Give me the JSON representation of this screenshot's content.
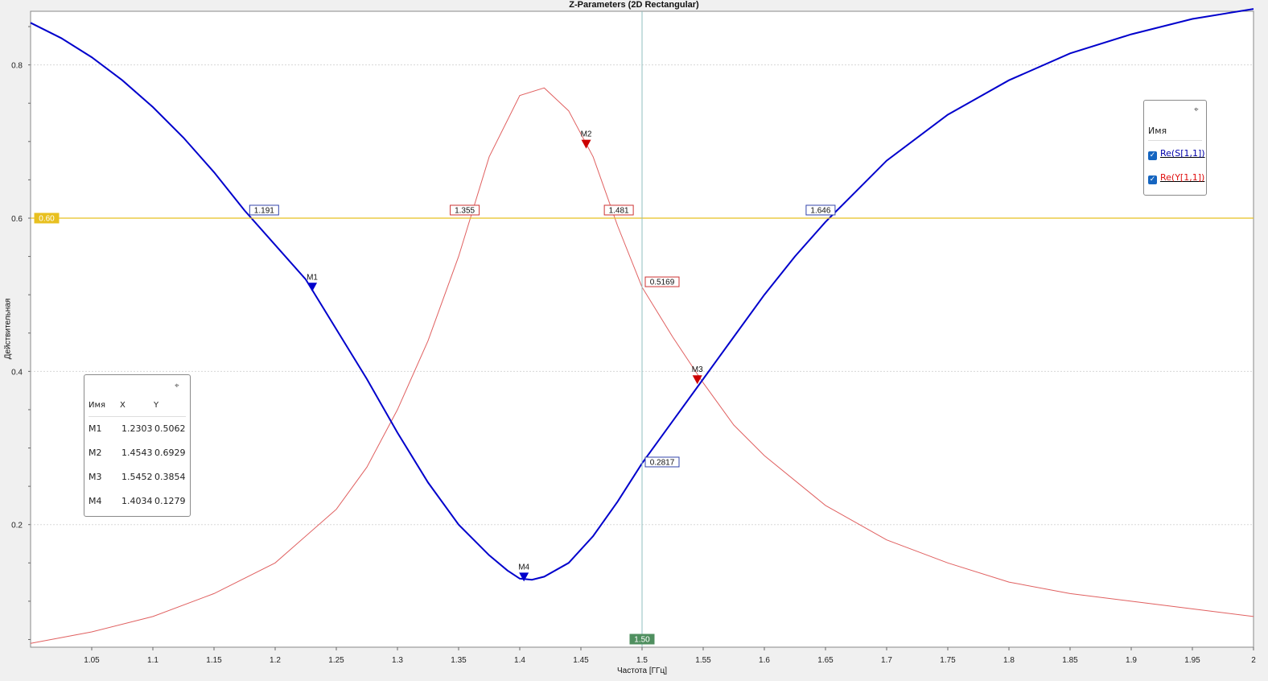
{
  "chart_data": {
    "type": "line",
    "title": "Z-Parameters (2D Rectangular)",
    "xlabel": "Частота [ГГц]",
    "ylabel": "Действительная",
    "xlim": [
      1.0,
      2.0
    ],
    "ylim": [
      0.04,
      0.87
    ],
    "x_ticks": [
      "1.05",
      "1.1",
      "1.15",
      "1.2",
      "1.25",
      "1.3",
      "1.35",
      "1.4",
      "1.45",
      "1.5",
      "1.55",
      "1.6",
      "1.65",
      "1.7",
      "1.75",
      "1.8",
      "1.85",
      "1.9",
      "1.95",
      "2"
    ],
    "y_ticks": [
      "0.2",
      "0.4",
      "0.6",
      "0.8"
    ],
    "grid": true,
    "legend_position": "top-right",
    "series": [
      {
        "name": "Re(S[1,1])",
        "color": "#0000cc",
        "x": [
          1.0,
          1.025,
          1.05,
          1.075,
          1.1,
          1.125,
          1.15,
          1.175,
          1.2,
          1.225,
          1.25,
          1.275,
          1.3,
          1.325,
          1.35,
          1.375,
          1.39,
          1.4,
          1.41,
          1.42,
          1.44,
          1.46,
          1.48,
          1.5,
          1.525,
          1.55,
          1.575,
          1.6,
          1.625,
          1.65,
          1.675,
          1.7,
          1.75,
          1.8,
          1.85,
          1.9,
          1.95,
          2.0
        ],
        "y": [
          0.855,
          0.835,
          0.81,
          0.78,
          0.745,
          0.705,
          0.66,
          0.61,
          0.565,
          0.52,
          0.455,
          0.39,
          0.32,
          0.255,
          0.2,
          0.16,
          0.14,
          0.1295,
          0.128,
          0.132,
          0.15,
          0.185,
          0.23,
          0.28,
          0.335,
          0.39,
          0.445,
          0.5,
          0.55,
          0.595,
          0.635,
          0.675,
          0.735,
          0.78,
          0.815,
          0.84,
          0.86,
          0.873
        ]
      },
      {
        "name": "Re(Y[1,1])",
        "color": "#e06060",
        "x": [
          1.0,
          1.05,
          1.1,
          1.15,
          1.2,
          1.25,
          1.275,
          1.3,
          1.325,
          1.35,
          1.375,
          1.4,
          1.42,
          1.44,
          1.46,
          1.48,
          1.5,
          1.525,
          1.55,
          1.575,
          1.6,
          1.65,
          1.7,
          1.75,
          1.8,
          1.85,
          1.9,
          1.95,
          2.0
        ],
        "y": [
          0.045,
          0.06,
          0.08,
          0.11,
          0.15,
          0.22,
          0.275,
          0.35,
          0.44,
          0.55,
          0.68,
          0.76,
          0.77,
          0.74,
          0.68,
          0.59,
          0.51,
          0.445,
          0.385,
          0.33,
          0.29,
          0.225,
          0.18,
          0.15,
          0.125,
          0.11,
          0.1,
          0.09,
          0.08
        ]
      }
    ],
    "markers": [
      {
        "name": "M1",
        "x": 1.2303,
        "y": 0.5062,
        "series": "Re(S[1,1])"
      },
      {
        "name": "M2",
        "x": 1.4543,
        "y": 0.6929,
        "series": "Re(Y[1,1])"
      },
      {
        "name": "M3",
        "x": 1.5452,
        "y": 0.3854,
        "series": "Re(Y[1,1])"
      },
      {
        "name": "M4",
        "x": 1.4034,
        "y": 0.1279,
        "series": "Re(S[1,1])"
      }
    ],
    "hline": {
      "y": 0.6,
      "label": "0.60",
      "color": "#e8c020"
    },
    "vline": {
      "x": 1.5,
      "label": "1.50",
      "color": "#8fbfbf"
    },
    "hline_crossings": [
      {
        "x": 1.191,
        "label": "1.191",
        "series": "Re(S[1,1])"
      },
      {
        "x": 1.355,
        "label": "1.355",
        "series": "Re(Y[1,1])"
      },
      {
        "x": 1.481,
        "label": "1.481",
        "series": "Re(Y[1,1])"
      },
      {
        "x": 1.646,
        "label": "1.646",
        "series": "Re(S[1,1])"
      }
    ],
    "vline_crossings": [
      {
        "y": 0.5169,
        "label": "0.5169",
        "series": "Re(Y[1,1])"
      },
      {
        "y": 0.2817,
        "label": "0.2817",
        "series": "Re(S[1,1])"
      }
    ]
  },
  "legend": {
    "header": "Имя",
    "items": [
      {
        "label": "Re(S[1,1])",
        "color": "#0000cc"
      },
      {
        "label": "Re(Y[1,1])",
        "color": "#e01010"
      }
    ]
  },
  "marker_table": {
    "headers": [
      "Имя",
      "X",
      "Y"
    ],
    "rows": [
      [
        "M1",
        "1.2303",
        "0.5062"
      ],
      [
        "M2",
        "1.4543",
        "0.6929"
      ],
      [
        "M3",
        "1.5452",
        "0.3854"
      ],
      [
        "M4",
        "1.4034",
        "0.1279"
      ]
    ]
  }
}
